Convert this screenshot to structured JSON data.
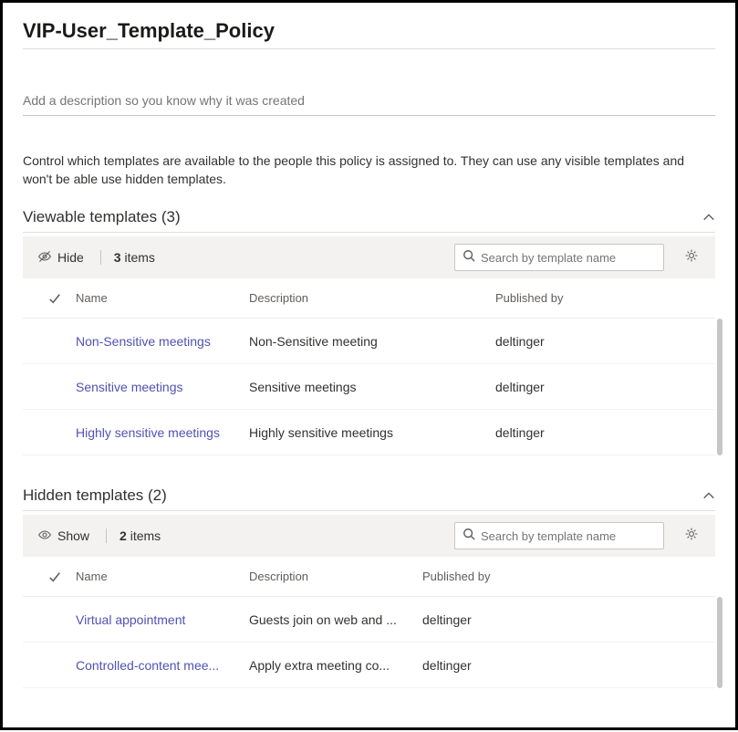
{
  "header": {
    "title": "VIP-User_Template_Policy"
  },
  "description": {
    "placeholder": "Add a description so you know why it was created"
  },
  "blurb": "Control which templates are available to the people this policy is assigned to. They can use any visible templates and won't be able use hidden templates.",
  "viewable": {
    "title": "Viewable templates (3)",
    "action_label": "Hide",
    "count_bold": "3",
    "count_rest": " items",
    "search_placeholder": "Search by template name",
    "columns": {
      "name": "Name",
      "desc": "Description",
      "pub": "Published by"
    },
    "rows": [
      {
        "name": "Non-Sensitive meetings",
        "desc": "Non-Sensitive meeting",
        "pub": "deltinger"
      },
      {
        "name": "Sensitive meetings",
        "desc": "Sensitive meetings",
        "pub": "deltinger"
      },
      {
        "name": "Highly sensitive meetings",
        "desc": "Highly sensitive meetings",
        "pub": "deltinger"
      }
    ]
  },
  "hidden": {
    "title": "Hidden templates (2)",
    "action_label": "Show",
    "count_bold": "2",
    "count_rest": " items",
    "search_placeholder": "Search by template name",
    "columns": {
      "name": "Name",
      "desc": "Description",
      "pub": "Published by"
    },
    "rows": [
      {
        "name": "Virtual appointment",
        "desc": "Guests join on web and ...",
        "pub": "deltinger"
      },
      {
        "name": "Controlled-content mee...",
        "desc": "Apply extra meeting co...",
        "pub": "deltinger"
      }
    ]
  }
}
